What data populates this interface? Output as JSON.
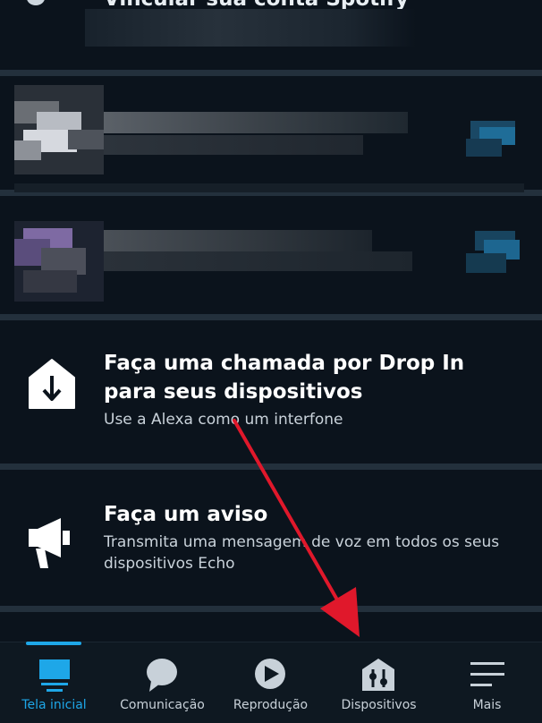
{
  "top_card": {
    "title": "Vincular sua conta Spotify"
  },
  "cards": [
    {
      "title": "Faça uma chamada por Drop In para seus dispositivos",
      "subtitle": "Use a Alexa como um interfone",
      "icon": "drop-in-icon"
    },
    {
      "title": "Faça um aviso",
      "subtitle": "Transmita uma mensagem de voz em todos os seus dispositivos Echo",
      "icon": "megaphone-icon"
    }
  ],
  "nav": {
    "items": [
      {
        "label": "Tela inicial",
        "icon": "home-icon",
        "active": true
      },
      {
        "label": "Comunicação",
        "icon": "chat-bubble-icon",
        "active": false
      },
      {
        "label": "Reprodução",
        "icon": "play-icon",
        "active": false
      },
      {
        "label": "Dispositivos",
        "icon": "devices-icon",
        "active": false
      },
      {
        "label": "Mais",
        "icon": "menu-icon",
        "active": false
      }
    ]
  },
  "colors": {
    "background": "#0b131c",
    "divider": "#23303c",
    "accent": "#1ea7e8",
    "arrow": "#e0182b"
  }
}
